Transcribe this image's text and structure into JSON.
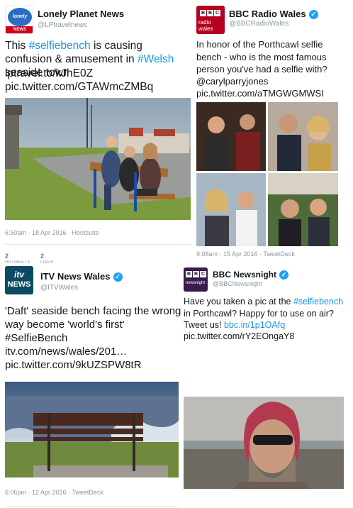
{
  "tweets": [
    {
      "name": "Lonely Planet News",
      "handle": "@LPtravelnews",
      "verified": false,
      "text_parts": [
        "This ",
        "#selfiebench",
        " is causing confusion & amusement in ",
        "#Welsh",
        " seaside town"
      ],
      "link1": "lptravel.to/kJhE0Z",
      "link2": "pic.twitter.com/GTAWmcZMBq",
      "meta": "6:50am · 18 Apr 2016 · Hootsuite",
      "retweets_count": "2",
      "retweets_label": "RETWEETS",
      "likes_count": "2",
      "likes_label": "LIKES",
      "avatar_top": "lonely planet",
      "avatar_bottom": "NEWS"
    },
    {
      "name": "BBC Radio Wales",
      "handle": "@BBCRadioWales",
      "verified": true,
      "text": "In honor of the Porthcawl selfie bench - who is the most famous person you've had a selfie with?",
      "mention": "@carylparryjones",
      "link": "pic.twitter.com/aTMGWGMWSI",
      "meta": "9:08am · 15 Apr 2016 · TweetDeck",
      "avatar_letters": [
        "B",
        "B",
        "C"
      ],
      "avatar_sub": "radio wales"
    },
    {
      "name": "ITV News Wales",
      "handle": "@ITVWales",
      "verified": true,
      "text": "'Daft' seaside bench facing the wrong way become 'world's first'",
      "hashtag": "#SelfieBench",
      "link1": "itv.com/news/wales/201…",
      "link2": "pic.twitter.com/9kUZSPW8tR",
      "meta": "6:06pm · 12 Apr 2016 · TweetDeck",
      "avatar_top": "itv",
      "avatar_bottom": "NEWS"
    },
    {
      "name": "BBC Newsnight",
      "handle": "@BBCNewsnight",
      "verified": true,
      "text_parts": [
        "Have you taken a pic at the ",
        "#selfiebench",
        " in Porthcawl? Happy for to use on air? Tweet us! "
      ],
      "link1": "bbc.in/1p1OAfq",
      "link2": "pic.twitter.com/rY2EOngaY8",
      "avatar_letters": [
        "B",
        "B",
        "C"
      ],
      "avatar_sub": "newsnight"
    }
  ],
  "colors": {
    "link": "#1b95e0",
    "verified": "#1da1f2",
    "meta": "#8899a6"
  }
}
